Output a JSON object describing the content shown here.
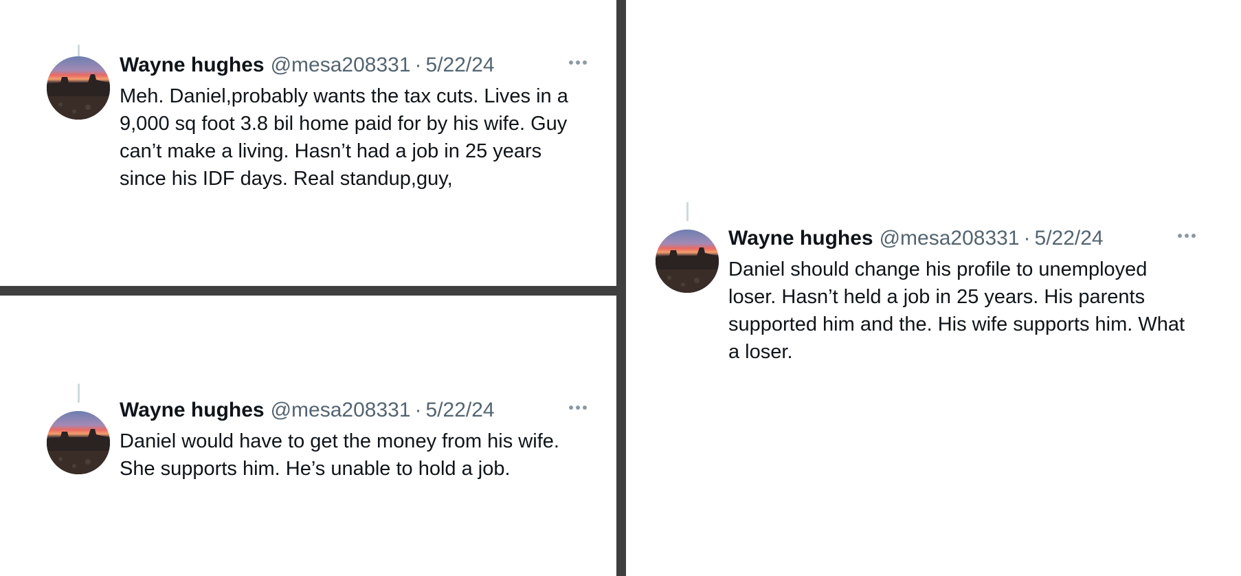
{
  "tweets": [
    {
      "author_name": "Wayne hughes",
      "handle": "@mesa208331",
      "separator": "·",
      "date": "5/22/24",
      "text": "Meh. Daniel,probably wants the tax cuts. Lives in a 9,000 sq foot 3.8 bil home paid for by his wife. Guy can’t make a living. Hasn’t had a job in 25 years since his IDF days. Real standup,guy,",
      "avatar_icon": "avatar-sunset-mesa-image",
      "more_icon": "more-options-icon"
    },
    {
      "author_name": "Wayne hughes",
      "handle": "@mesa208331",
      "separator": "·",
      "date": "5/22/24",
      "text": "Daniel would have to get the money from his wife. She supports him. He’s unable to hold a job.",
      "avatar_icon": "avatar-sunset-mesa-image",
      "more_icon": "more-options-icon"
    },
    {
      "author_name": "Wayne hughes",
      "handle": "@mesa208331",
      "separator": "·",
      "date": "5/22/24",
      "text": "Daniel should change his profile to unemployed loser. Hasn’t held a job in 25 years. His parents supported him and the. His wife supports him. What a loser.",
      "avatar_icon": "avatar-sunset-mesa-image",
      "more_icon": "more-options-icon"
    }
  ],
  "colors": {
    "divider": "#3f3f3f",
    "text_primary": "#0f1419",
    "text_secondary": "#536471",
    "thread_line": "#cfd9de"
  }
}
